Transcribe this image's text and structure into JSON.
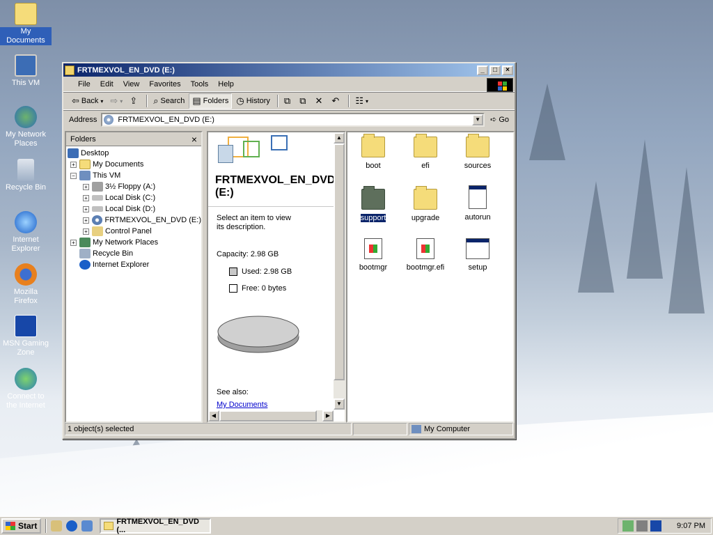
{
  "desktop": {
    "icons": [
      {
        "label": "My Documents"
      },
      {
        "label": "This VM"
      },
      {
        "label": "My Network Places"
      },
      {
        "label": "Recycle Bin"
      },
      {
        "label": "Internet Explorer"
      },
      {
        "label": "Mozilla Firefox"
      },
      {
        "label": "MSN Gaming Zone"
      },
      {
        "label": "Connect to the Internet"
      }
    ]
  },
  "window": {
    "title": "FRTMEXVOL_EN_DVD (E:)",
    "menu": [
      "File",
      "Edit",
      "View",
      "Favorites",
      "Tools",
      "Help"
    ],
    "toolbar": {
      "back": "Back",
      "search": "Search",
      "folders": "Folders",
      "history": "History"
    },
    "address": {
      "label": "Address",
      "value": "FRTMEXVOL_EN_DVD (E:)",
      "go": "Go"
    },
    "folders_pane": {
      "header": "Folders",
      "tree": [
        {
          "label": "Desktop"
        },
        {
          "label": "My Documents"
        },
        {
          "label": "This VM"
        },
        {
          "label": "3½ Floppy (A:)"
        },
        {
          "label": "Local Disk (C:)"
        },
        {
          "label": "Local Disk (D:)"
        },
        {
          "label": "FRTMEXVOL_EN_DVD (E:)"
        },
        {
          "label": "Control Panel"
        },
        {
          "label": "My Network Places"
        },
        {
          "label": "Recycle Bin"
        },
        {
          "label": "Internet Explorer"
        }
      ]
    },
    "info_pane": {
      "title": "FRTMEXVOL_EN_DVD (E:)",
      "description": "Select an item to view its description.",
      "capacity": "Capacity: 2.98 GB",
      "used": "Used: 2.98 GB",
      "free": "Free: 0 bytes",
      "see_also": "See also:",
      "link": "My Documents"
    },
    "files": [
      {
        "label": "boot",
        "type": "folder"
      },
      {
        "label": "efi",
        "type": "folder"
      },
      {
        "label": "sources",
        "type": "folder"
      },
      {
        "label": "support",
        "type": "folder"
      },
      {
        "label": "upgrade",
        "type": "folder"
      },
      {
        "label": "autorun",
        "type": "file"
      },
      {
        "label": "bootmgr",
        "type": "file"
      },
      {
        "label": "bootmgr.efi",
        "type": "file"
      },
      {
        "label": "setup",
        "type": "file"
      }
    ],
    "status": {
      "left": "1 object(s) selected",
      "right": "My Computer"
    }
  },
  "taskbar": {
    "start": "Start",
    "task": "FRTMEXVOL_EN_DVD (...",
    "clock": "9:07 PM"
  },
  "colors": {
    "titlebar": "#0a246a",
    "selection": "#0a246a",
    "face": "#d4d0c8"
  }
}
